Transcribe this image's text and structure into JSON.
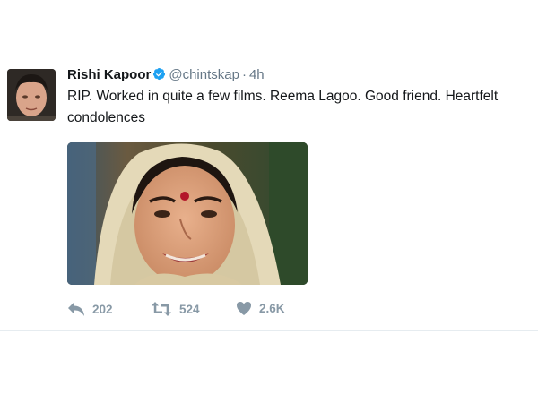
{
  "tweet": {
    "author_name": "Rishi Kapoor",
    "handle": "@chintskap",
    "separator": "·",
    "time": "4h",
    "text": "RIP. Worked in quite a few films. Reema Lagoo. Good friend. Heartfelt condolences"
  },
  "actions": {
    "reply_count": "202",
    "retweet_count": "524",
    "like_count": "2.6K"
  },
  "icons": {
    "verified": "verified-badge-icon",
    "reply": "reply-icon",
    "retweet": "retweet-icon",
    "like": "heart-icon"
  },
  "colors": {
    "verified_blue": "#1da1f2",
    "meta_gray": "#657786",
    "action_gray": "#8899a6"
  }
}
